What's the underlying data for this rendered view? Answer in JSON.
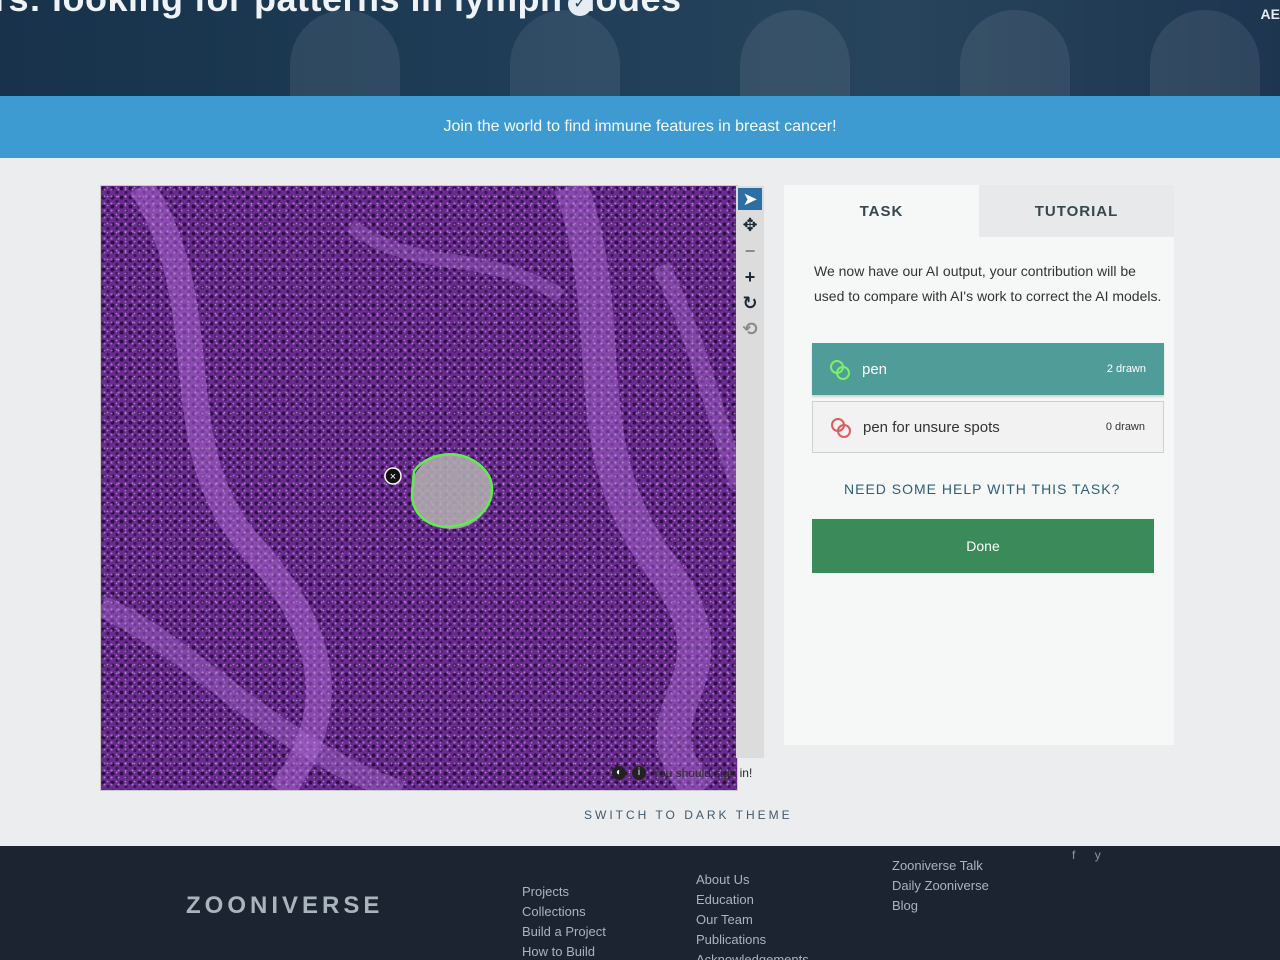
{
  "hero": {
    "title": "rs: looking for patterns in lymph nodes",
    "lang": "AE"
  },
  "banner": {
    "text": "Join the world to find immune features in breast cancer!"
  },
  "toolbar": [
    "pointer",
    "move",
    "zoom-out",
    "zoom-in",
    "rotate",
    "reset"
  ],
  "meta": {
    "signin_text": "You should sign in!"
  },
  "theme_toggle": "SWITCH TO DARK THEME",
  "task": {
    "tabs": [
      "TASK",
      "TUTORIAL"
    ],
    "instructions": "We now have our AI output, your contribution will be used to compare with AI's work to correct the AI models.",
    "tools": [
      {
        "label": "pen",
        "count": "2 drawn",
        "color": "#4f9c99"
      },
      {
        "label": "pen for unsure spots",
        "count": "0 drawn",
        "color": "#f2f2f2"
      }
    ],
    "help": "NEED SOME HELP WITH THIS TASK?",
    "done": "Done"
  },
  "footer": {
    "brand": "ZOONIVERSE",
    "col1": [
      "Projects",
      "Collections",
      "Build a Project",
      "How to Build"
    ],
    "col2": [
      "About Us",
      "Education",
      "Our Team",
      "Publications",
      "Acknowledgements"
    ],
    "col3": [
      "Zooniverse Talk",
      "Daily Zooniverse",
      "Blog"
    ],
    "social": [
      "f",
      "y"
    ]
  }
}
